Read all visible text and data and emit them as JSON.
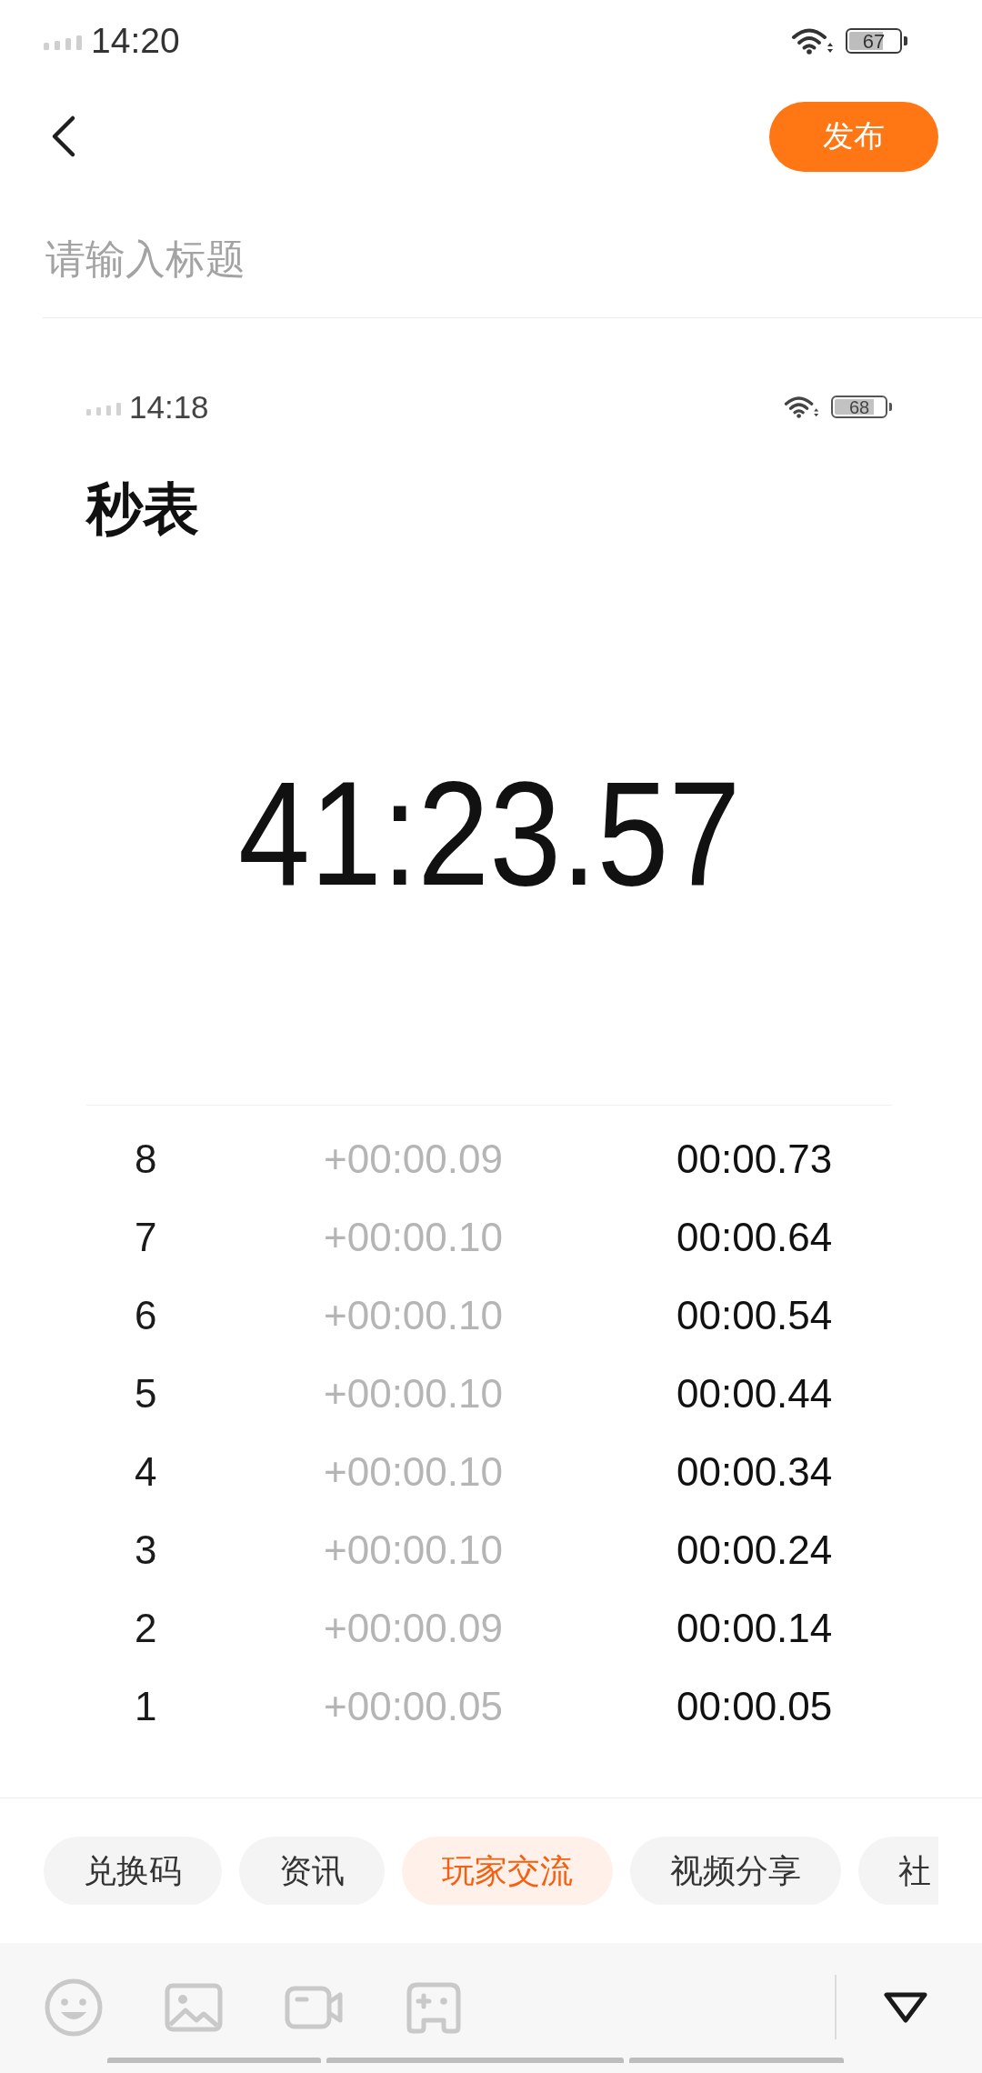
{
  "status_bar": {
    "time": "14:20",
    "battery": "67"
  },
  "header": {
    "publish_button": "发布"
  },
  "title_field": {
    "placeholder": "请输入标题"
  },
  "attached_screenshot": {
    "status_bar": {
      "time": "14:18",
      "battery": "68"
    },
    "app_title": "秒表",
    "elapsed_time": "41:23.57",
    "laps": [
      {
        "number": "8",
        "split": "+00:00.09",
        "total": "00:00.73"
      },
      {
        "number": "7",
        "split": "+00:00.10",
        "total": "00:00.64"
      },
      {
        "number": "6",
        "split": "+00:00.10",
        "total": "00:00.54"
      },
      {
        "number": "5",
        "split": "+00:00.10",
        "total": "00:00.44"
      },
      {
        "number": "4",
        "split": "+00:00.10",
        "total": "00:00.34"
      },
      {
        "number": "3",
        "split": "+00:00.10",
        "total": "00:00.24"
      },
      {
        "number": "2",
        "split": "+00:00.09",
        "total": "00:00.14"
      },
      {
        "number": "1",
        "split": "+00:00.05",
        "total": "00:00.05"
      }
    ]
  },
  "tags": [
    {
      "label": "兑换码",
      "selected": false
    },
    {
      "label": "资讯",
      "selected": false
    },
    {
      "label": "玩家交流",
      "selected": true
    },
    {
      "label": "视频分享",
      "selected": false
    },
    {
      "label": "社",
      "selected": false
    }
  ]
}
